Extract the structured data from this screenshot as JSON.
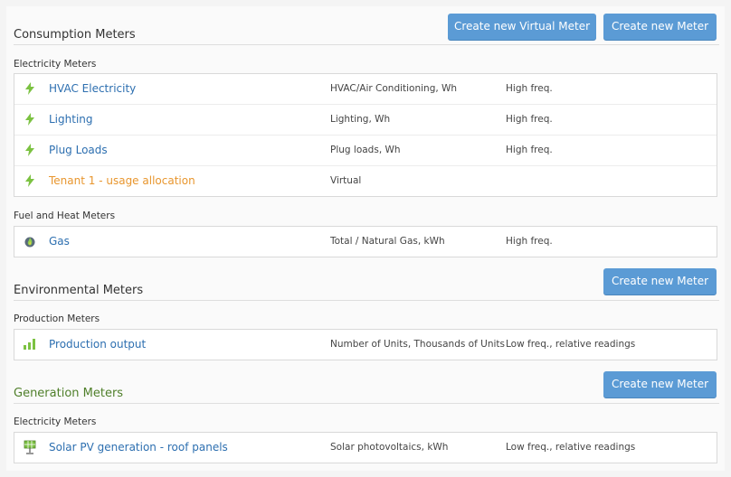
{
  "consumption": {
    "title": "Consumption Meters",
    "btn_virtual": "Create new Virtual Meter",
    "btn_meter": "Create new Meter",
    "groups": [
      {
        "label": "Electricity Meters",
        "rows": [
          {
            "icon": "lightning-icon",
            "name": "HVAC Electricity",
            "desc": "HVAC/Air Conditioning, Wh",
            "freq": "High freq."
          },
          {
            "icon": "lightning-icon",
            "name": "Lighting",
            "desc": "Lighting, Wh",
            "freq": "High freq."
          },
          {
            "icon": "lightning-icon",
            "name": "Plug Loads",
            "desc": "Plug loads, Wh",
            "freq": "High freq."
          },
          {
            "icon": "lightning-icon",
            "name": "Tenant 1 - usage allocation",
            "desc": "Virtual",
            "freq": ""
          }
        ]
      },
      {
        "label": "Fuel and Heat Meters",
        "rows": [
          {
            "icon": "flame-icon",
            "name": "Gas",
            "desc": "Total / Natural Gas, kWh",
            "freq": "High freq."
          }
        ]
      }
    ]
  },
  "environmental": {
    "title": "Environmental Meters",
    "btn_meter": "Create new Meter",
    "groups": [
      {
        "label": "Production Meters",
        "rows": [
          {
            "icon": "bar-chart-icon",
            "name": "Production output",
            "desc": "Number of Units, Thousands of Units",
            "freq": "Low freq., relative readings"
          }
        ]
      }
    ]
  },
  "generation": {
    "title": "Generation Meters",
    "btn_meter": "Create new Meter",
    "groups": [
      {
        "label": "Electricity Meters",
        "rows": [
          {
            "icon": "solar-panel-icon",
            "name": "Solar PV generation - roof panels",
            "desc": "Solar photovoltaics, kWh",
            "freq": "Low freq., relative readings"
          }
        ]
      }
    ]
  },
  "colors": {
    "button": "#5b9bd5",
    "link": "#2d6fb0",
    "virtual_link": "#e8962e",
    "icon_green": "#7cc242",
    "generation_title": "#4f7f2a"
  }
}
